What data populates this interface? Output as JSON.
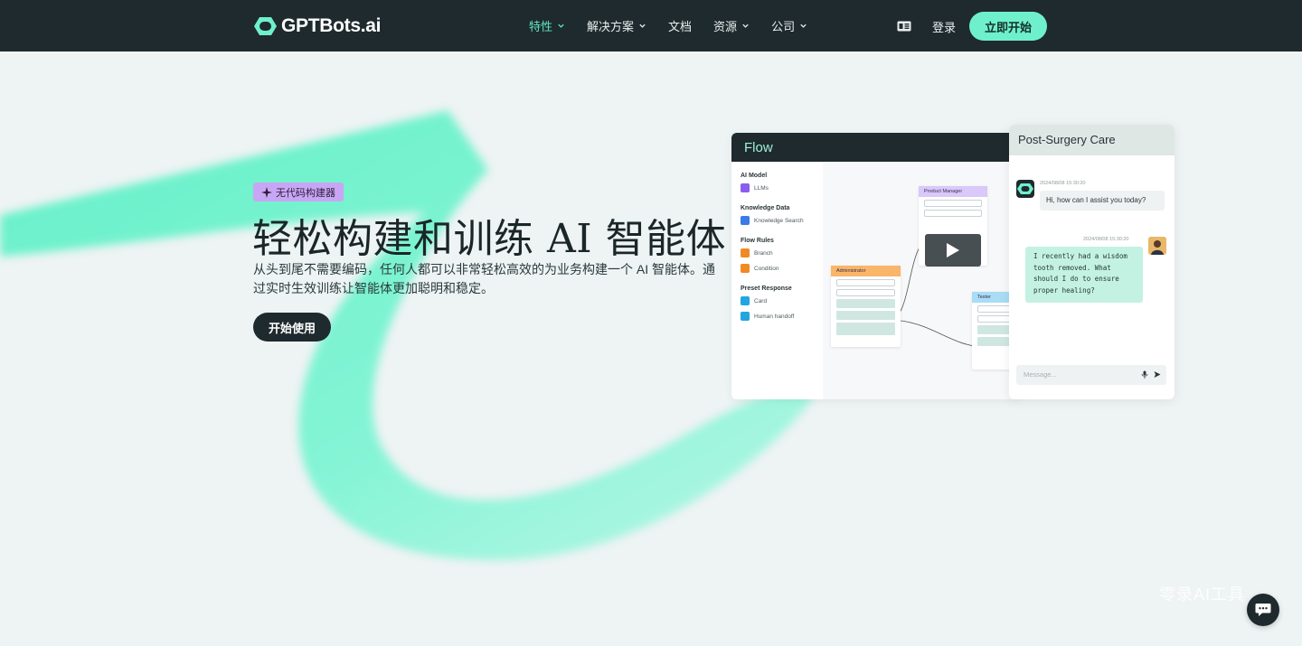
{
  "nav": {
    "logo_text": "GPTBots.ai",
    "items": [
      {
        "label": "特性",
        "dropdown": true,
        "active": true
      },
      {
        "label": "解决方案",
        "dropdown": true,
        "active": false
      },
      {
        "label": "文档",
        "dropdown": false,
        "active": false
      },
      {
        "label": "资源",
        "dropdown": true,
        "active": false
      },
      {
        "label": "公司",
        "dropdown": true,
        "active": false
      }
    ],
    "language_icon": "language-icon",
    "login_label": "登录",
    "start_label": "立即开始"
  },
  "hero": {
    "badge": "无代码构建器",
    "title": "轻松构建和训练 AI 智能体",
    "description": "从头到尾不需要编码，任何人都可以非常轻松高效的为业务构建一个 AI 智能体。通过实时生效训练让智能体更加聪明和稳定。",
    "cta_label": "开始使用"
  },
  "flow_card": {
    "title": "Flow",
    "groups": [
      {
        "title": "AI Model",
        "items": [
          {
            "label": "LLMs",
            "color": "#8a5cf0"
          }
        ]
      },
      {
        "title": "Knowledge Data",
        "items": [
          {
            "label": "Knowledge Search",
            "color": "#3a7be8"
          }
        ]
      },
      {
        "title": "Flow Rules",
        "items": [
          {
            "label": "Branch",
            "color": "#f08a24"
          },
          {
            "label": "Condition",
            "color": "#f08a24"
          }
        ]
      },
      {
        "title": "Preset Response",
        "items": [
          {
            "label": "Card",
            "color": "#22a6e0"
          },
          {
            "label": "Human handoff",
            "color": "#22a6e0"
          }
        ]
      }
    ],
    "nodes": {
      "product_manager": "Product Manager",
      "administrator": "Administrator",
      "tester": "Tester"
    }
  },
  "chat_card": {
    "title": "Post-Surgery Care",
    "bot_timestamp": "2024/08/08 15:30:20",
    "bot_message": "Hi, how can I assist you today?",
    "user_timestamp": "2024/08/08 15:30:20",
    "user_message": "I recently had a wisdom tooth removed. What should I do to ensure proper healing?",
    "input_placeholder": "Message..."
  },
  "watermark": "零录AI工具",
  "colors": {
    "nav_bg": "#1f2a2e",
    "accent": "#6ff0cc",
    "active_nav": "#5ee8bd",
    "badge": "#c9a6f5",
    "page_bg": "#eef3f3"
  }
}
